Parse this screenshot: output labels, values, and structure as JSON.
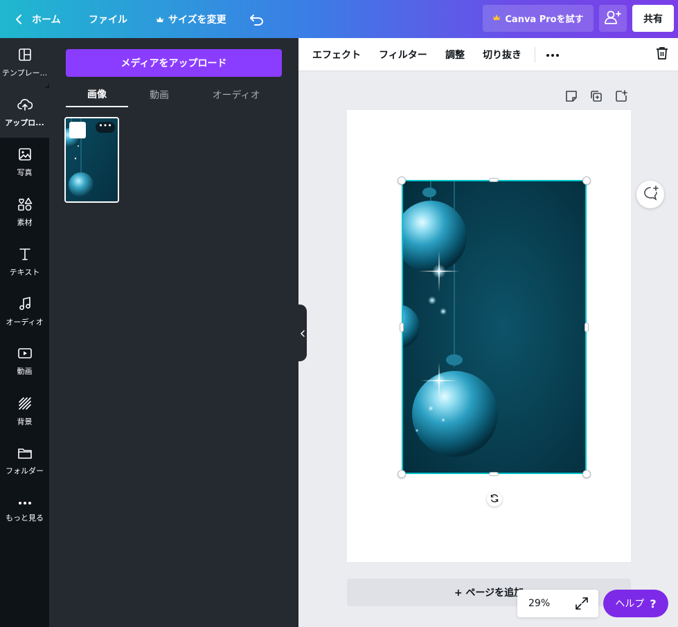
{
  "topbar": {
    "home_label": "ホーム",
    "file_label": "ファイル",
    "resize_label": "サイズを変更",
    "pro_label": "Canva Proを試す",
    "share_label": "共有"
  },
  "rail": {
    "items": [
      {
        "label": "テンプレー...",
        "icon": "template-icon"
      },
      {
        "label": "アップロ...",
        "icon": "upload-cloud-icon"
      },
      {
        "label": "写真",
        "icon": "photo-icon"
      },
      {
        "label": "素材",
        "icon": "elements-icon"
      },
      {
        "label": "テキスト",
        "icon": "text-icon"
      },
      {
        "label": "オーディオ",
        "icon": "music-note-icon"
      },
      {
        "label": "動画",
        "icon": "video-icon"
      },
      {
        "label": "背景",
        "icon": "background-icon"
      },
      {
        "label": "フォルダー",
        "icon": "folder-icon"
      },
      {
        "label": "もっと見る",
        "icon": "more-icon"
      }
    ]
  },
  "panel": {
    "upload_button": "メディアをアップロード",
    "tabs": [
      "画像",
      "動画",
      "オーディオ"
    ],
    "active_tab": "画像",
    "thumb_more": "•••"
  },
  "context_toolbar": {
    "effects": "エフェクト",
    "filter": "フィルター",
    "adjust": "調整",
    "crop": "切り抜き"
  },
  "canvas": {
    "add_page": "+ ページを追加",
    "zoom": "29%"
  },
  "help": {
    "label": "ヘルプ",
    "icon_text": "?"
  },
  "colors": {
    "accent_purple": "#8b3dff",
    "selection_teal": "#00c4cc",
    "panel_bg": "#252a31",
    "rail_bg": "#0e1318"
  }
}
